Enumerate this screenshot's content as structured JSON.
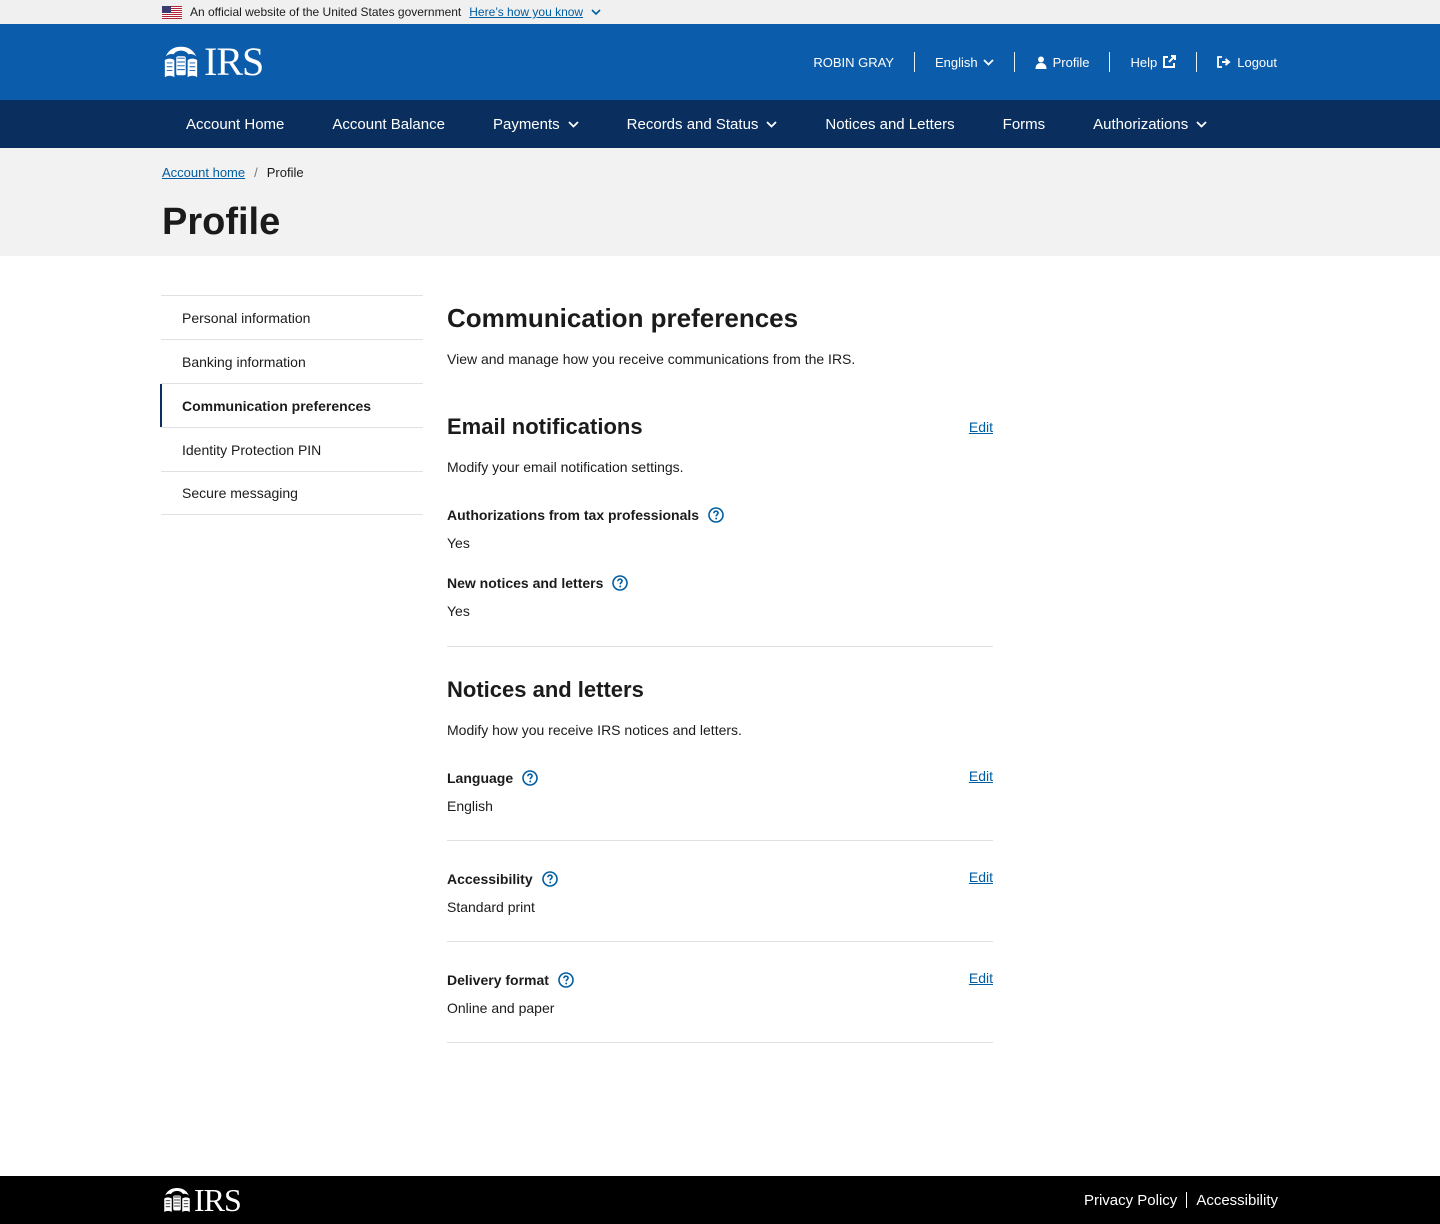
{
  "gov_banner": {
    "text": "An official website of the United States government",
    "link": "Here’s how you know"
  },
  "header": {
    "logo_text": "IRS",
    "user_name": "ROBIN GRAY",
    "language": "English",
    "profile": "Profile",
    "help": "Help",
    "logout": "Logout"
  },
  "nav": {
    "items": [
      {
        "label": "Account Home"
      },
      {
        "label": "Account Balance"
      },
      {
        "label": "Payments"
      },
      {
        "label": "Records and Status"
      },
      {
        "label": "Notices and Letters"
      },
      {
        "label": "Forms"
      },
      {
        "label": "Authorizations"
      }
    ]
  },
  "breadcrumb": {
    "home": "Account home",
    "separator": "/",
    "current": "Profile"
  },
  "page_title": "Profile",
  "sidenav": {
    "items": [
      {
        "label": "Personal information"
      },
      {
        "label": "Banking information"
      },
      {
        "label": "Communication preferences"
      },
      {
        "label": "Identity Protection PIN"
      },
      {
        "label": "Secure messaging"
      }
    ],
    "active": "Communication preferences"
  },
  "main": {
    "title": "Communication preferences",
    "intro": "View and manage how you receive communications from the IRS.",
    "email": {
      "heading": "Email notifications",
      "edit": "Edit",
      "description": "Modify your email notification settings.",
      "fields": [
        {
          "label": "Authorizations from tax professionals",
          "value": "Yes"
        },
        {
          "label": "New notices and letters",
          "value": "Yes"
        }
      ]
    },
    "notices": {
      "heading": "Notices and letters",
      "description": "Modify how you receive IRS notices and letters.",
      "fields": [
        {
          "label": "Language",
          "value": "English",
          "edit": "Edit"
        },
        {
          "label": "Accessibility",
          "value": "Standard print",
          "edit": "Edit"
        },
        {
          "label": "Delivery format",
          "value": "Online and paper",
          "edit": "Edit"
        }
      ]
    }
  },
  "footer": {
    "logo_text": "IRS",
    "privacy": "Privacy Policy",
    "accessibility": "Accessibility"
  },
  "colors": {
    "header_blue": "#0b5cab",
    "nav_navy": "#0a2f5e",
    "link_blue": "#005ea2",
    "footer_black": "#000000"
  },
  "icons": {
    "flag": "us-flag-icon",
    "chevron": "chevron-down-icon",
    "profile": "person-icon",
    "help": "external-link-icon",
    "logout": "logout-icon",
    "help_circle": "question-circle-icon",
    "eagle": "irs-eagle-logo"
  }
}
